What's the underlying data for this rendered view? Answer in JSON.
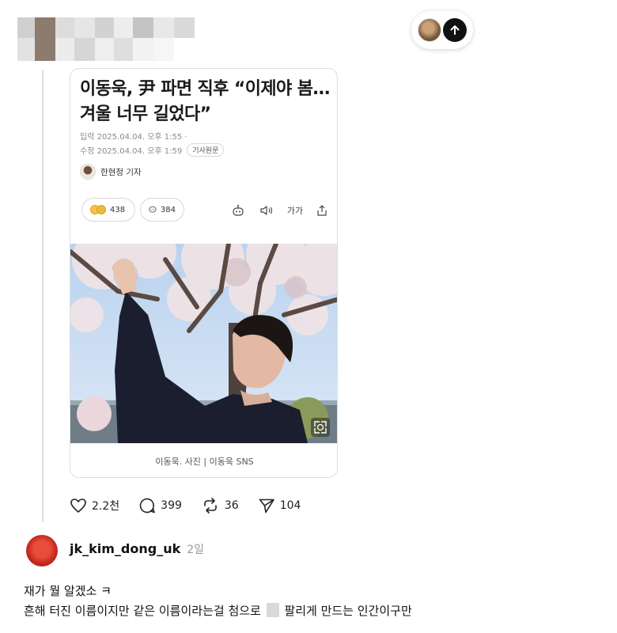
{
  "header": {
    "username_blurred": true,
    "blur_colors": [
      "#c9c9c9",
      "#8a7a6e",
      "#d6d6d6",
      "#e4e4e4",
      "#bfbfbf",
      "#ececec",
      "#cfcfcf",
      "#e0e0e0",
      "#d0d0d0"
    ],
    "avatar_icon": "user-avatar-icon",
    "scroll_top_icon": "arrow-up-icon"
  },
  "article": {
    "title": "이동욱, 尹 파면 직후 “이제야 봄…겨울 너무 길었다”",
    "published": "입력 2025.04.04. 오후 1:55 ·",
    "modified": "수정 2025.04.04. 오후 1:59",
    "original_button": "기사원문",
    "reporter": "한현정 기자",
    "reaction_count": "438",
    "comment_count": "384",
    "font_size_label": "가가",
    "caption": "이동욱. 사진 | 이동욱 SNS"
  },
  "engagement": {
    "likes": "2.2천",
    "comments": "399",
    "reposts": "36",
    "shares": "104"
  },
  "reply": {
    "username": "jk_kim_dong_uk",
    "time": "2일",
    "line1": "재가 뭘 알겠소 ㅋ",
    "line2_before": "흔해 터진 이름이지만 같은 이름이라는걸 첨으로",
    "line2_after": "팔리게 만드는 인간이구만"
  }
}
